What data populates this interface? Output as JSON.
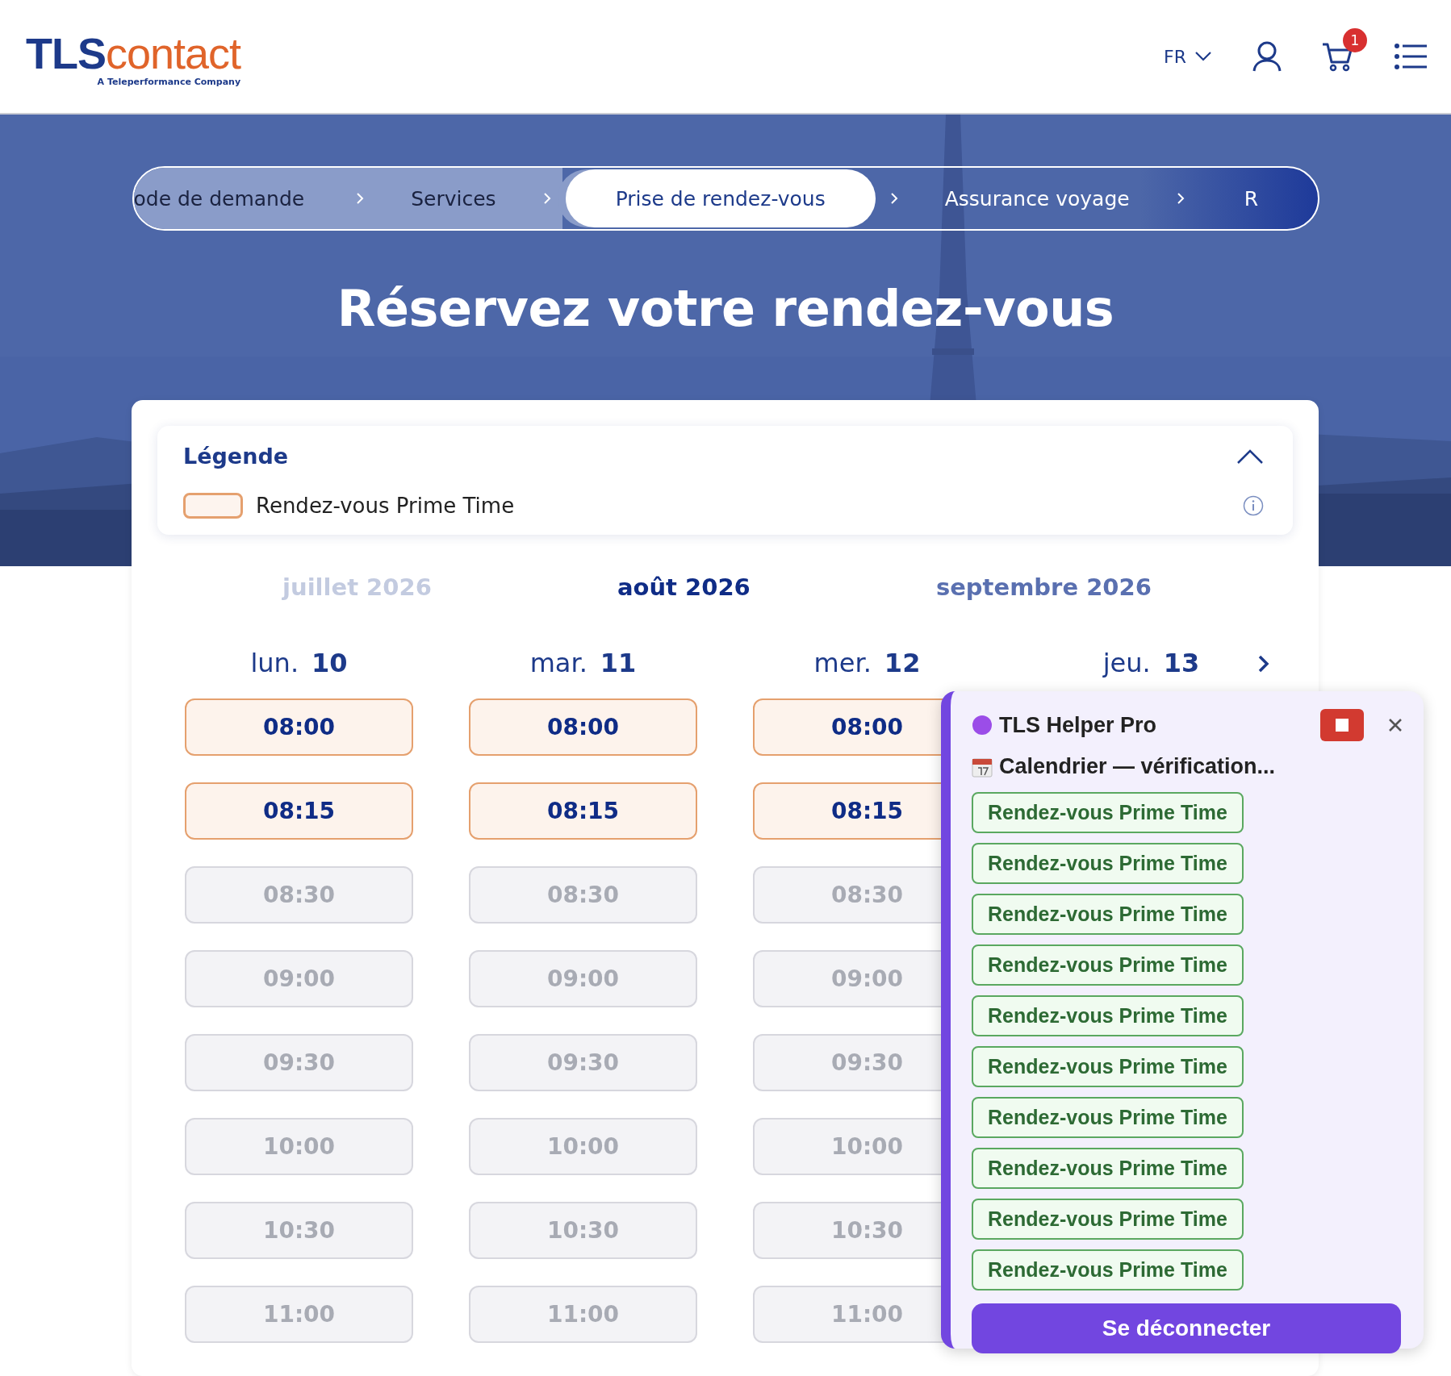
{
  "header": {
    "logo": {
      "brand": "TLS",
      "brand_suffix": "contact",
      "tagline": "A Teleperformance Company"
    },
    "language": "FR",
    "cart_count": "1"
  },
  "steps": [
    {
      "label": "ode de demande",
      "selected": false,
      "completed": true
    },
    {
      "label": "Services",
      "selected": false,
      "completed": true
    },
    {
      "label": "Prise de rendez-vous",
      "selected": true,
      "completed": false
    },
    {
      "label": "Assurance voyage",
      "selected": false,
      "completed": false
    },
    {
      "label": "R",
      "selected": false,
      "completed": false
    }
  ],
  "title": "Réservez votre rendez-vous",
  "legend": {
    "title": "Légende",
    "expanded": true,
    "items": [
      {
        "label": "Rendez-vous Prime Time"
      }
    ]
  },
  "months": [
    {
      "label": "juillet 2026",
      "kind": "past"
    },
    {
      "label": "août 2026",
      "kind": "current"
    },
    {
      "label": "septembre 2026",
      "kind": "next"
    }
  ],
  "days": [
    {
      "weekday": "lun.",
      "day": "10",
      "slots": [
        {
          "time": "08:00",
          "kind": "prime"
        },
        {
          "time": "08:15",
          "kind": "prime"
        },
        {
          "time": "08:30",
          "kind": "unavailable"
        },
        {
          "time": "09:00",
          "kind": "unavailable"
        },
        {
          "time": "09:30",
          "kind": "unavailable"
        },
        {
          "time": "10:00",
          "kind": "unavailable"
        },
        {
          "time": "10:30",
          "kind": "unavailable"
        },
        {
          "time": "11:00",
          "kind": "unavailable"
        }
      ]
    },
    {
      "weekday": "mar.",
      "day": "11",
      "slots": [
        {
          "time": "08:00",
          "kind": "prime"
        },
        {
          "time": "08:15",
          "kind": "prime"
        },
        {
          "time": "08:30",
          "kind": "unavailable"
        },
        {
          "time": "09:00",
          "kind": "unavailable"
        },
        {
          "time": "09:30",
          "kind": "unavailable"
        },
        {
          "time": "10:00",
          "kind": "unavailable"
        },
        {
          "time": "10:30",
          "kind": "unavailable"
        },
        {
          "time": "11:00",
          "kind": "unavailable"
        }
      ]
    },
    {
      "weekday": "mer.",
      "day": "12",
      "slots": [
        {
          "time": "08:00",
          "kind": "prime"
        },
        {
          "time": "08:15",
          "kind": "prime"
        },
        {
          "time": "08:30",
          "kind": "unavailable"
        },
        {
          "time": "09:00",
          "kind": "unavailable"
        },
        {
          "time": "09:30",
          "kind": "unavailable"
        },
        {
          "time": "10:00",
          "kind": "unavailable"
        },
        {
          "time": "10:30",
          "kind": "unavailable"
        },
        {
          "time": "11:00",
          "kind": "unavailable"
        }
      ]
    },
    {
      "weekday": "jeu.",
      "day": "13"
    }
  ],
  "helper": {
    "title": "TLS Helper Pro",
    "status": "Calendrier — vérification...",
    "results": [
      "Rendez-vous Prime Time",
      "Rendez-vous Prime Time",
      "Rendez-vous Prime Time",
      "Rendez-vous Prime Time",
      "Rendez-vous Prime Time",
      "Rendez-vous Prime Time",
      "Rendez-vous Prime Time",
      "Rendez-vous Prime Time",
      "Rendez-vous Prime Time",
      "Rendez-vous Prime Time"
    ],
    "button": "Se déconnecter"
  }
}
